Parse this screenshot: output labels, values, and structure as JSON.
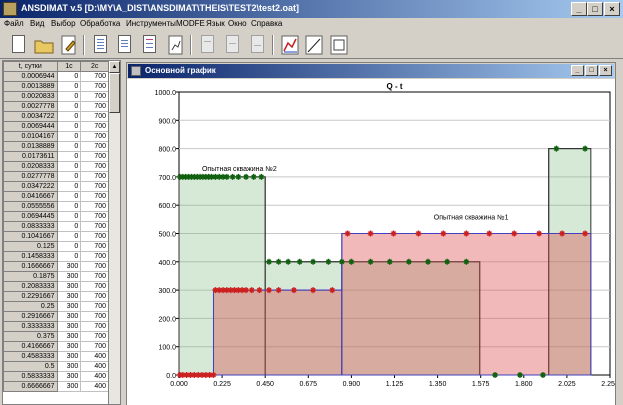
{
  "window": {
    "title": "ANSDIMAT v.5  [D:\\MY\\A_DIST\\ANSDIMAT\\THEIS\\TEST2\\test2.oat]"
  },
  "menu": [
    "Файл",
    "Вид",
    "Выбор",
    "Обработка",
    "Инструменты",
    "MODFE",
    "Язык",
    "Окно",
    "Справка"
  ],
  "grid": {
    "headers": [
      "t, сутки",
      "1с",
      "2с"
    ],
    "rows": [
      [
        "0.0006944",
        "0",
        "700"
      ],
      [
        "0.0013889",
        "0",
        "700"
      ],
      [
        "0.0020833",
        "0",
        "700"
      ],
      [
        "0.0027778",
        "0",
        "700"
      ],
      [
        "0.0034722",
        "0",
        "700"
      ],
      [
        "0.0069444",
        "0",
        "700"
      ],
      [
        "0.0104167",
        "0",
        "700"
      ],
      [
        "0.0138889",
        "0",
        "700"
      ],
      [
        "0.0173611",
        "0",
        "700"
      ],
      [
        "0.0208333",
        "0",
        "700"
      ],
      [
        "0.0277778",
        "0",
        "700"
      ],
      [
        "0.0347222",
        "0",
        "700"
      ],
      [
        "0.0416667",
        "0",
        "700"
      ],
      [
        "0.0555556",
        "0",
        "700"
      ],
      [
        "0.0694445",
        "0",
        "700"
      ],
      [
        "0.0833333",
        "0",
        "700"
      ],
      [
        "0.1041667",
        "0",
        "700"
      ],
      [
        "0.125",
        "0",
        "700"
      ],
      [
        "0.1458333",
        "0",
        "700"
      ],
      [
        "0.1666667",
        "300",
        "700"
      ],
      [
        "0.1875",
        "300",
        "700"
      ],
      [
        "0.2083333",
        "300",
        "700"
      ],
      [
        "0.2291667",
        "300",
        "700"
      ],
      [
        "0.25",
        "300",
        "700"
      ],
      [
        "0.2916667",
        "300",
        "700"
      ],
      [
        "0.3333333",
        "300",
        "700"
      ],
      [
        "0.375",
        "300",
        "700"
      ],
      [
        "0.4166667",
        "300",
        "700"
      ],
      [
        "0.4583333",
        "300",
        "400"
      ],
      [
        "0.5",
        "300",
        "400"
      ],
      [
        "0.5833333",
        "300",
        "400"
      ],
      [
        "0.6666667",
        "300",
        "400"
      ]
    ]
  },
  "chart_window": {
    "title": "Основной график"
  },
  "chart_data": {
    "type": "line",
    "title": "Q - t",
    "xlim": [
      0,
      2.25
    ],
    "ylim": [
      0,
      1000
    ],
    "xticks": [
      "0.000",
      "0.225",
      "0.450",
      "0.675",
      "0.900",
      "1.125",
      "1.350",
      "1.575",
      "1.800",
      "2.025",
      "2.250"
    ],
    "yticks": [
      "0.0",
      "100.0",
      "200.0",
      "300.0",
      "400.0",
      "500.0",
      "600.0",
      "700.0",
      "800.0",
      "900.0",
      "1000.0"
    ],
    "annotations": [
      {
        "text": "Опытная скважина №2",
        "x": 0.12,
        "y": 720
      },
      {
        "text": "Опытная скважина №1",
        "x": 1.33,
        "y": 550
      }
    ],
    "series": [
      {
        "steps": [
          [
            0,
            0.18,
            0
          ],
          [
            0.18,
            0.85,
            300
          ],
          [
            0.85,
            2.15,
            500
          ]
        ],
        "markers": [
          [
            0.005,
            0
          ],
          [
            0.02,
            0
          ],
          [
            0.04,
            0
          ],
          [
            0.06,
            0
          ],
          [
            0.08,
            0
          ],
          [
            0.1,
            0
          ],
          [
            0.12,
            0
          ],
          [
            0.14,
            0
          ],
          [
            0.16,
            0
          ],
          [
            0.18,
            0
          ],
          [
            0.19,
            300
          ],
          [
            0.21,
            300
          ],
          [
            0.23,
            300
          ],
          [
            0.25,
            300
          ],
          [
            0.27,
            300
          ],
          [
            0.29,
            300
          ],
          [
            0.31,
            300
          ],
          [
            0.33,
            300
          ],
          [
            0.35,
            300
          ],
          [
            0.38,
            300
          ],
          [
            0.42,
            300
          ],
          [
            0.47,
            300
          ],
          [
            0.52,
            300
          ],
          [
            0.6,
            300
          ],
          [
            0.7,
            300
          ],
          [
            0.8,
            300
          ],
          [
            0.88,
            500
          ],
          [
            1.0,
            500
          ],
          [
            1.12,
            500
          ],
          [
            1.25,
            500
          ],
          [
            1.38,
            500
          ],
          [
            1.5,
            500
          ],
          [
            1.62,
            500
          ],
          [
            1.75,
            500
          ],
          [
            1.88,
            500
          ],
          [
            2.0,
            500
          ],
          [
            2.12,
            500
          ]
        ],
        "color": "#cc2020",
        "fill": "rgba(220,80,80,0.4)",
        "line": "#4040c0"
      },
      {
        "steps": [
          [
            0,
            0.45,
            700
          ],
          [
            0.45,
            0.85,
            400
          ],
          [
            0.85,
            1.57,
            400
          ],
          [
            1.57,
            1.93,
            0
          ],
          [
            1.93,
            2.15,
            800
          ]
        ],
        "markers": [
          [
            0.005,
            700
          ],
          [
            0.02,
            700
          ],
          [
            0.035,
            700
          ],
          [
            0.05,
            700
          ],
          [
            0.065,
            700
          ],
          [
            0.08,
            700
          ],
          [
            0.095,
            700
          ],
          [
            0.11,
            700
          ],
          [
            0.125,
            700
          ],
          [
            0.14,
            700
          ],
          [
            0.155,
            700
          ],
          [
            0.17,
            700
          ],
          [
            0.19,
            700
          ],
          [
            0.21,
            700
          ],
          [
            0.23,
            700
          ],
          [
            0.25,
            700
          ],
          [
            0.28,
            700
          ],
          [
            0.31,
            700
          ],
          [
            0.35,
            700
          ],
          [
            0.39,
            700
          ],
          [
            0.43,
            700
          ],
          [
            0.47,
            400
          ],
          [
            0.52,
            400
          ],
          [
            0.57,
            400
          ],
          [
            0.63,
            400
          ],
          [
            0.7,
            400
          ],
          [
            0.78,
            400
          ],
          [
            0.85,
            400
          ],
          [
            0.9,
            400
          ],
          [
            1.0,
            400
          ],
          [
            1.1,
            400
          ],
          [
            1.2,
            400
          ],
          [
            1.3,
            400
          ],
          [
            1.4,
            400
          ],
          [
            1.5,
            400
          ],
          [
            1.65,
            0
          ],
          [
            1.78,
            0
          ],
          [
            1.9,
            0
          ],
          [
            1.97,
            800
          ],
          [
            2.12,
            800
          ]
        ],
        "color": "#106010",
        "fill": "rgba(120,180,120,0.3)",
        "line": "#303030"
      }
    ]
  }
}
